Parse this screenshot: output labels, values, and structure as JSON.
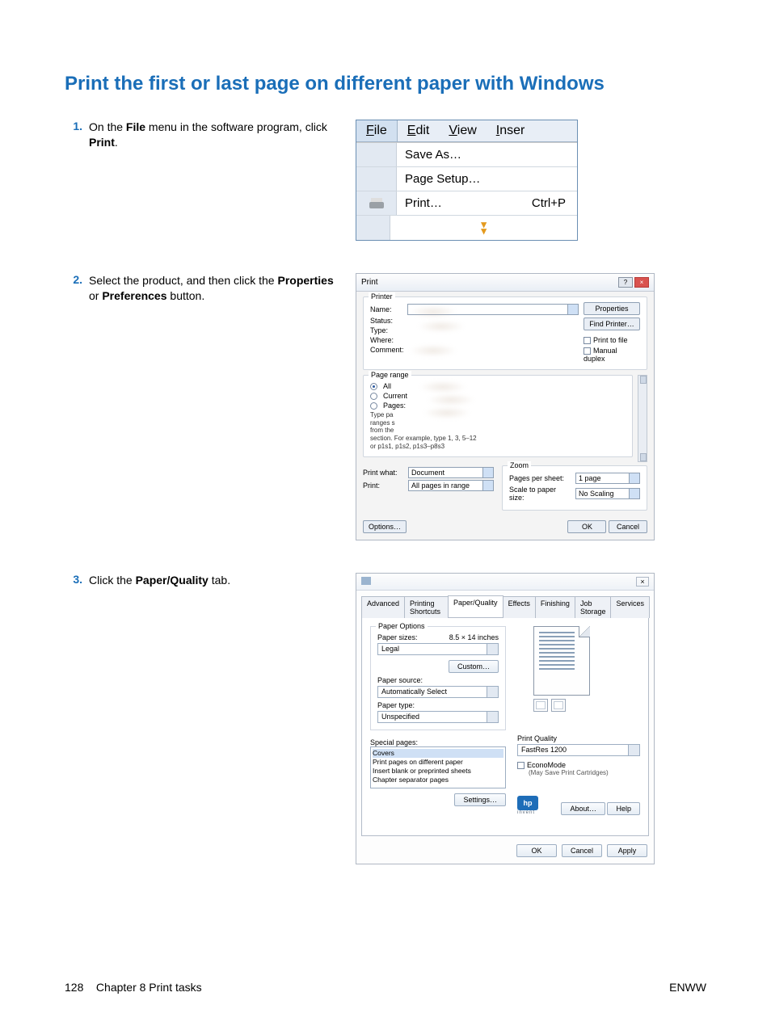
{
  "section_title": "Print the first or last page on different paper with Windows",
  "steps": [
    {
      "num": "1.",
      "text_parts": [
        "On the ",
        "File",
        " menu in the software program, click ",
        "Print",
        "."
      ]
    },
    {
      "num": "2.",
      "text_parts": [
        "Select the product, and then click the ",
        "Properties",
        " or ",
        "Preferences",
        " button."
      ]
    },
    {
      "num": "3.",
      "text_parts": [
        "Click the ",
        "Paper/Quality",
        " tab."
      ]
    }
  ],
  "fig1": {
    "menubar": [
      "File",
      "Edit",
      "View",
      "Inser"
    ],
    "items": {
      "save_as": "Save As…",
      "page_setup": "Page Setup…",
      "print": "Print…",
      "print_shortcut": "Ctrl+P"
    }
  },
  "fig2": {
    "title": "Print",
    "printer_group": "Printer",
    "labels": {
      "name": "Name:",
      "status": "Status:",
      "type": "Type:",
      "where": "Where:",
      "comment": "Comment:"
    },
    "buttons": {
      "properties": "Properties",
      "find_printer": "Find Printer…",
      "print_to_file": "Print to file",
      "manual_duplex": "Manual duplex"
    },
    "range_group": "Page range",
    "range": {
      "all": "All",
      "current": "Current",
      "pages": "Pages:",
      "hint1": "Type pa",
      "hint2": "ranges s",
      "hint3": "from the",
      "hint4": "section. For example, type 1, 3, 5–12",
      "hint5": "or p1s1, p1s2, p1s3–p8s3"
    },
    "print_what_label": "Print what:",
    "print_what_value": "Document",
    "print_label": "Print:",
    "print_value": "All pages in range",
    "zoom_group": "Zoom",
    "pages_per_sheet_label": "Pages per sheet:",
    "pages_per_sheet_value": "1 page",
    "scale_label": "Scale to paper size:",
    "scale_value": "No Scaling",
    "options": "Options…",
    "ok": "OK",
    "cancel": "Cancel"
  },
  "fig3": {
    "close_glyph": "×",
    "tabs": [
      "Advanced",
      "Printing Shortcuts",
      "Paper/Quality",
      "Effects",
      "Finishing",
      "Job Storage",
      "Services"
    ],
    "active_tab": "Paper/Quality",
    "paper_options": "Paper Options",
    "paper_sizes_label": "Paper sizes:",
    "paper_size_dim": "8.5 × 14 inches",
    "paper_size_value": "Legal",
    "custom_btn": "Custom…",
    "paper_source_label": "Paper source:",
    "paper_source_value": "Automatically Select",
    "paper_type_label": "Paper type:",
    "paper_type_value": "Unspecified",
    "special_pages_label": "Special pages:",
    "special_list": [
      "Covers",
      "Print pages on different paper",
      "Insert blank or preprinted sheets",
      "Chapter separator pages"
    ],
    "settings_btn": "Settings…",
    "print_quality_label": "Print Quality",
    "print_quality_value": "FastRes 1200",
    "economode_label": "EconoMode",
    "economode_hint": "(May Save Print Cartridges)",
    "hp": "hp",
    "hp_sub": "invent",
    "about": "About…",
    "help": "Help",
    "ok": "OK",
    "cancel": "Cancel",
    "apply": "Apply"
  },
  "footer": {
    "page_no": "128",
    "chapter": "Chapter 8   Print tasks",
    "right": "ENWW"
  }
}
